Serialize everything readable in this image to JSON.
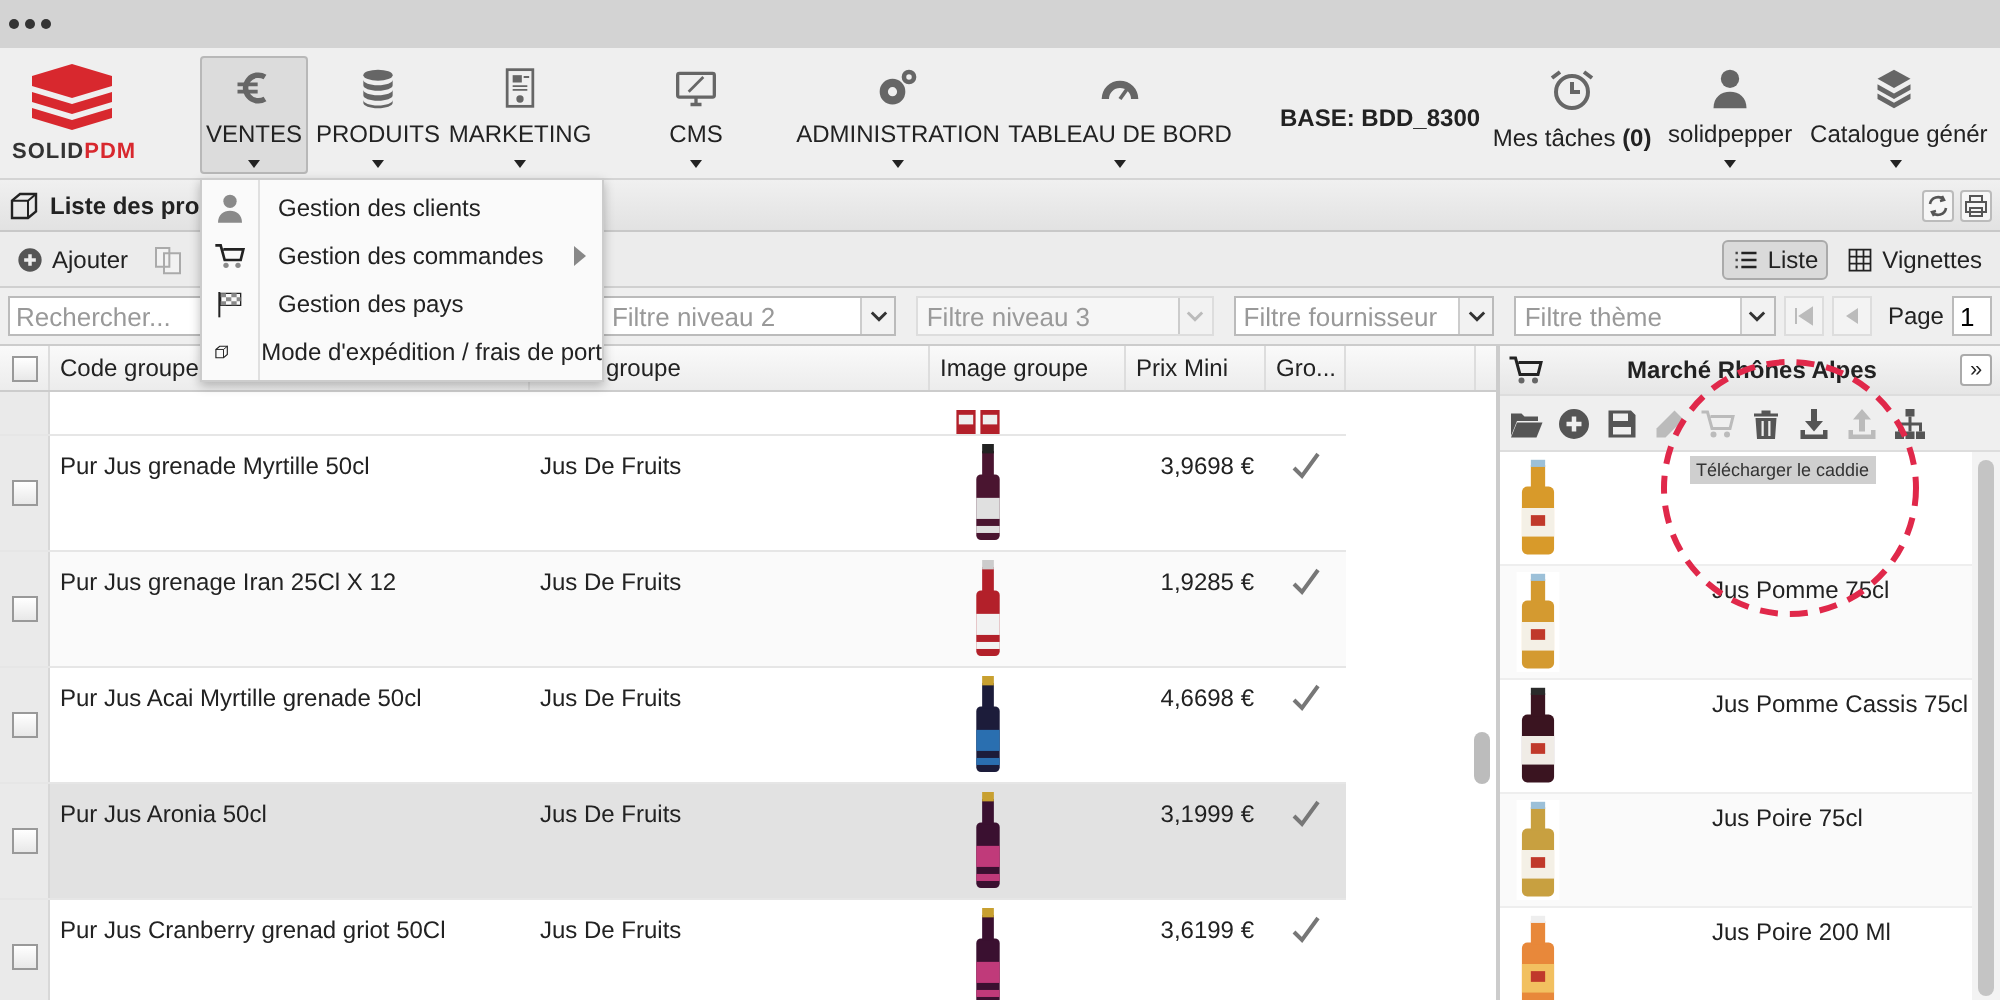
{
  "logo": {
    "name_start": "SOLID",
    "name_end": "PDM"
  },
  "nav": [
    {
      "label": "VENTES",
      "kind": "euro",
      "selected": true
    },
    {
      "label": "PRODUITS",
      "kind": "database",
      "selected": false
    },
    {
      "label": "MARKETING",
      "kind": "document",
      "selected": false
    },
    {
      "label": "CMS",
      "kind": "monitor",
      "selected": false
    },
    {
      "label": "ADMINISTRATION",
      "kind": "gears",
      "selected": false
    },
    {
      "label": "TABLEAU DE BORD",
      "kind": "gauge",
      "selected": false
    }
  ],
  "base_label": "BASE: BDD_8300",
  "user_menu": [
    {
      "label": "Mes tâches **(0)**",
      "kind": "clock",
      "has_caret": false
    },
    {
      "label": "solidpepper",
      "kind": "user",
      "has_caret": true
    },
    {
      "label": "Catalogue génér",
      "kind": "books",
      "has_caret": true
    }
  ],
  "dropdown_menu": [
    {
      "label": "Gestion des clients",
      "kind": "person",
      "has_submenu": false
    },
    {
      "label": "Gestion des commandes",
      "kind": "cart",
      "has_submenu": true
    },
    {
      "label": "Gestion des pays",
      "kind": "flag",
      "has_submenu": false
    },
    {
      "label": "Mode d'expédition / frais de port",
      "kind": "box",
      "has_submenu": false
    }
  ],
  "page_title": "Liste des pro",
  "toolbar": {
    "add": "Ajouter",
    "views": [
      {
        "label": "Liste",
        "kind": "list",
        "selected": true
      },
      {
        "label": "Vignettes",
        "kind": "grid",
        "selected": false
      }
    ]
  },
  "filters": {
    "search": {
      "placeholder": "Rechercher..."
    },
    "selects": [
      {
        "placeholder": "Filtre niveau 2",
        "disabled": false
      },
      {
        "placeholder": "Filtre niveau 3",
        "disabled": true
      },
      {
        "placeholder": "Filtre fournisseur",
        "disabled": false
      },
      {
        "placeholder": "Filtre thème",
        "disabled": false
      }
    ],
    "page_label": "Page",
    "page_value": "1"
  },
  "table": {
    "select_all_checked": false,
    "columns": [
      "Code groupe",
      "groupe",
      "Image groupe",
      "Prix Mini",
      "Gro..."
    ],
    "top_partial_row": {
      "kind": "picture"
    },
    "rows": [
      {
        "code": "Pur Jus grenade Myrtille 50cl",
        "group": "Jus De Fruits",
        "image": {
          "kind": "picture"
        },
        "price": "3,9698 €",
        "grouped": true,
        "checked": false,
        "selected": false
      },
      {
        "code": "Pur Jus grenage Iran 25Cl X 12",
        "group": "Jus De Fruits",
        "image": {
          "kind": "picture"
        },
        "price": "1,9285 €",
        "grouped": true,
        "checked": false,
        "selected": false
      },
      {
        "code": "Pur Jus Acai Myrtille grenade 50cl",
        "group": "Jus De Fruits",
        "image": {
          "kind": "picture"
        },
        "price": "4,6698 €",
        "grouped": true,
        "checked": false,
        "selected": false
      },
      {
        "code": "Pur Jus Aronia 50cl",
        "group": "Jus De Fruits",
        "image": {
          "kind": "picture"
        },
        "price": "3,1999 €",
        "grouped": true,
        "checked": false,
        "selected": true
      },
      {
        "code": "Pur Jus Cranberry grenad griot 50Cl",
        "group": "Jus De Fruits",
        "image": {
          "kind": "picture"
        },
        "price": "3,6199 €",
        "grouped": true,
        "checked": false,
        "selected": false
      }
    ]
  },
  "cart_panel": {
    "title": "Marché Rhônes Alpes",
    "expand": "»",
    "tools": [
      {
        "kind": "folder",
        "disabled": false
      },
      {
        "kind": "plus",
        "disabled": false
      },
      {
        "kind": "save",
        "disabled": false
      },
      {
        "kind": "pencil",
        "disabled": true
      },
      {
        "kind": "cart",
        "disabled": true
      },
      {
        "kind": "trash",
        "disabled": false
      },
      {
        "kind": "download",
        "disabled": false
      },
      {
        "kind": "upload",
        "disabled": true
      },
      {
        "kind": "sitemap",
        "disabled": false
      }
    ],
    "tooltip": "Télécharger le caddie",
    "items": [
      {
        "picture": {
          "kind": "picture"
        }
      },
      {
        "picture": {
          "kind": "picture"
        },
        "name": "Jus Pomme 75cl"
      },
      {
        "picture": {
          "kind": "picture"
        },
        "name": "Jus Pomme Cassis 75cl"
      },
      {
        "picture": {
          "kind": "picture"
        },
        "name": "Jus Poire 75cl"
      },
      {
        "picture": {
          "kind": "picture"
        },
        "name": "Jus Poire 200 Ml"
      }
    ]
  }
}
